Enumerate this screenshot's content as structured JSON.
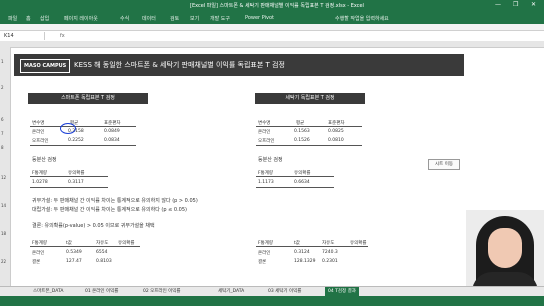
{
  "titlebar": {
    "title": "[Excel 파일] 스마트폰 & 세탁기 판매채널별 이익률 독립표본 T 검정.xlsx - Excel",
    "search": "수행할 작업을 입력하세요",
    "controls": [
      "—",
      "❐",
      "✕"
    ]
  },
  "ribbon": {
    "tabs": [
      "파일",
      "홈",
      "삽입",
      "페이지 레이아웃",
      "수식",
      "데이터",
      "검토",
      "보기",
      "개발 도구",
      "Power Pivot"
    ]
  },
  "formula_bar": {
    "name_box": "K14",
    "fx": "fx"
  },
  "banner": {
    "logo": "MASO CAMPUS",
    "title": "KESS 해 동일한 스마트폰 & 세탁기 판매채널별 이익률 독립표본 T 검정"
  },
  "left_panel": {
    "header": "스마트폰 독립표본 T 검정",
    "stats_headers": [
      "변수명",
      "평균",
      "표준편차"
    ],
    "stats_rows": [
      [
        "온라인",
        "0.2158",
        "0.0849"
      ],
      [
        "오프라인",
        "0.2252",
        "0.0834"
      ]
    ],
    "levene_title": "등분산 검정",
    "levene_headers": [
      "F통계량",
      "유의확률"
    ],
    "levene_values": [
      "1.0278",
      "0.3117"
    ],
    "decision_label": "결론",
    "t_headers": [
      "F통계량",
      "t값",
      "자유도",
      "유의확률"
    ],
    "t_values": [
      "0.5349",
      "6554",
      "127.47",
      "0.8103"
    ]
  },
  "right_panel": {
    "header": "세탁기 독립표본 T 검정",
    "stats_headers": [
      "변수명",
      "평균",
      "표준편차"
    ],
    "stats_rows": [
      [
        "온라인",
        "0.1563",
        "0.0825"
      ],
      [
        "오프라인",
        "0.1526",
        "0.0810"
      ]
    ],
    "levene_title": "등분산 검정",
    "levene_headers": [
      "F통계량",
      "유의확률"
    ],
    "levene_values": [
      "1.1173",
      "0.6634"
    ],
    "decision_label": "결론",
    "t_headers": [
      "F통계량",
      "t값",
      "자유도",
      "유의확률"
    ],
    "t_values": [
      "0.3124",
      "7240.3",
      "128.1329",
      "0.2301"
    ]
  },
  "notes": [
    "귀무가설: 두 판매채널 간 이익률 차이는 통계적으로 유의하지 않다 (p > 0.05)",
    "대립가설: 두 판매채널 간 이익률 차이는 통계적으로 유의하다 (p ≤ 0.05)",
    "결론: 유의확률(p-value) > 0.05 이므로 귀무가설을 채택"
  ],
  "side_button": "시트 이동",
  "sheet_tabs": [
    "스마트폰_DATA",
    "01 온라인 이익률",
    "02 오프라인 이익률",
    "세탁기_DATA",
    "03 세탁기 이익률",
    "04 T검정 결과"
  ],
  "active_tab": 5,
  "colors": {
    "excel_green": "#217346",
    "banner_dark": "#3a3a3a",
    "pen_blue": "#1a3fd6"
  }
}
